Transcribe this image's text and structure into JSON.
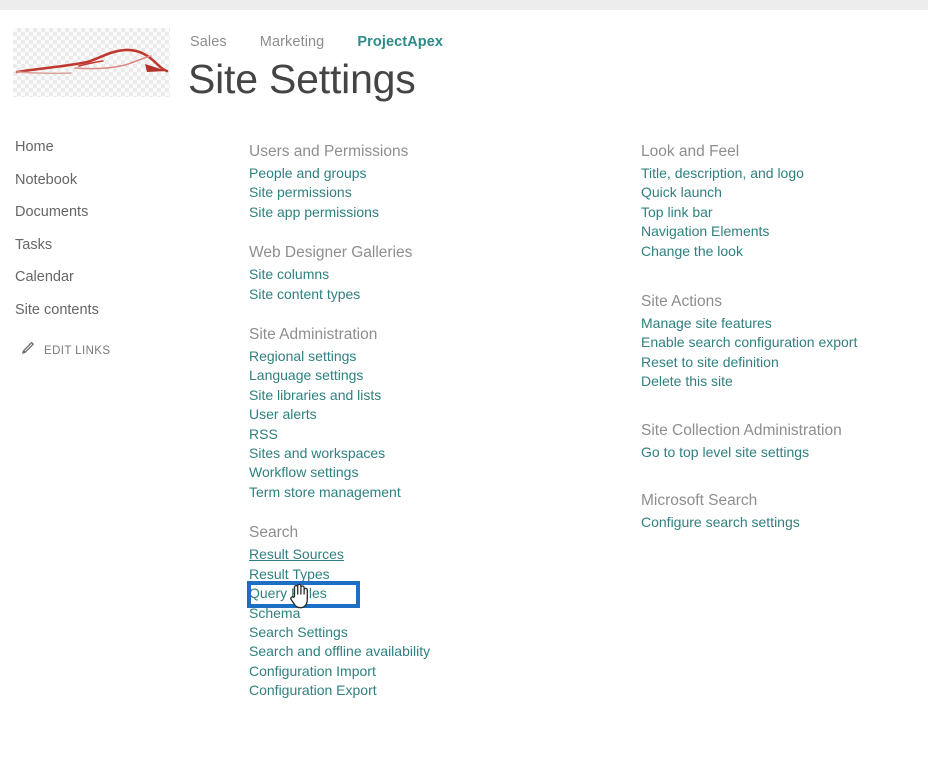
{
  "colors": {
    "link_teal": "#2f8080",
    "heading_gray": "#8e8e8e",
    "active_tab": "#2f8a8a",
    "highlight_blue": "#1d6fc4",
    "logo_red": "#c0392f",
    "top_strip": "#ededed"
  },
  "header": {
    "logo_alt": "car-logo",
    "title": "Site Settings",
    "tabs": [
      {
        "label": "Sales",
        "active": false
      },
      {
        "label": "Marketing",
        "active": false
      },
      {
        "label": "ProjectApex",
        "active": true
      }
    ]
  },
  "sidebar": {
    "items": [
      {
        "label": "Home"
      },
      {
        "label": "Notebook"
      },
      {
        "label": "Documents"
      },
      {
        "label": "Tasks"
      },
      {
        "label": "Calendar"
      },
      {
        "label": "Site contents"
      }
    ],
    "edit_links": {
      "label": "EDIT LINKS",
      "icon": "pencil-icon"
    }
  },
  "columns": {
    "middle": [
      {
        "heading": "Users and Permissions",
        "links": [
          "People and groups",
          "Site permissions",
          "Site app permissions"
        ]
      },
      {
        "heading": "Web Designer Galleries",
        "links": [
          "Site columns",
          "Site content types"
        ]
      },
      {
        "heading": "Site Administration",
        "links": [
          "Regional settings",
          "Language settings",
          "Site libraries and lists",
          "User alerts",
          "RSS",
          "Sites and workspaces",
          "Workflow settings",
          "Term store management"
        ]
      },
      {
        "heading": "Search",
        "links": [
          "Result Sources",
          "Result Types",
          "Query Rules",
          "Schema",
          "Search Settings",
          "Search and offline availability",
          "Configuration Import",
          "Configuration Export"
        ]
      }
    ],
    "right": [
      {
        "heading": "Look and Feel",
        "links": [
          "Title, description, and logo",
          "Quick launch",
          "Top link bar",
          "Navigation Elements",
          "Change the look"
        ]
      },
      {
        "heading": "Site Actions",
        "links": [
          "Manage site features",
          "Enable search configuration export",
          "Reset to site definition",
          "Delete this site"
        ]
      },
      {
        "heading": "Site Collection Administration",
        "links": [
          "Go to top level site settings"
        ]
      },
      {
        "heading": "Microsoft Search",
        "links": [
          "Configure search settings"
        ]
      }
    ]
  },
  "annotation": {
    "highlighted_link": "Result Sources",
    "cursor": "hand-pointer-cursor"
  }
}
